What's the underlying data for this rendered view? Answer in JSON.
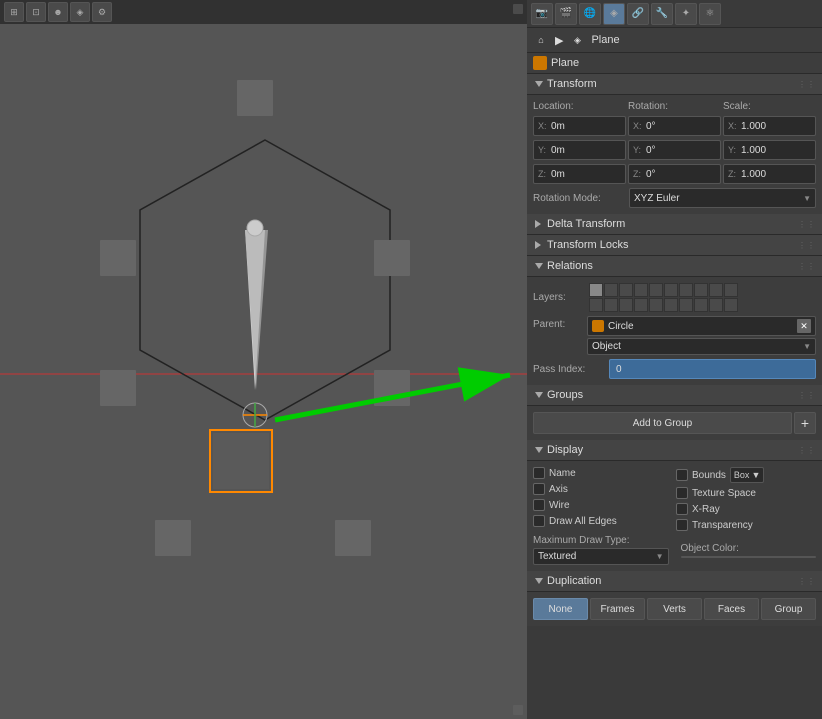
{
  "viewport": {
    "background_color": "#555555"
  },
  "toolbar": {
    "icons": [
      "⊞",
      "⊡",
      "○",
      "◉",
      "⚙",
      "↗",
      "⊿",
      "▦",
      "✦"
    ]
  },
  "header": {
    "object_type_icon": "✦",
    "object_name": "Plane",
    "breadcrumb_arrow": "▶",
    "plane_icon_label": "Plane"
  },
  "transform": {
    "section_label": "Transform",
    "location_label": "Location:",
    "rotation_label": "Rotation:",
    "scale_label": "Scale:",
    "x_label": "X:",
    "y_label": "Y:",
    "z_label": "Z:",
    "loc_x": "0m",
    "loc_y": "0m",
    "loc_z": "0m",
    "rot_x": "0°",
    "rot_y": "0°",
    "rot_z": "0°",
    "scale_x": "1.000",
    "scale_y": "1.000",
    "scale_z": "1.000",
    "rotation_mode_label": "Rotation Mode:",
    "rotation_mode_value": "XYZ Euler"
  },
  "delta_transform": {
    "section_label": "Delta Transform"
  },
  "transform_locks": {
    "section_label": "Transform Locks"
  },
  "relations": {
    "section_label": "Relations",
    "layers_label": "Layers:",
    "parent_label": "Parent:",
    "parent_value": "Circle",
    "parent_type_value": "Object",
    "pass_index_label": "Pass Index:",
    "pass_index_value": "0"
  },
  "groups": {
    "section_label": "Groups",
    "add_to_group_label": "Add to Group"
  },
  "display": {
    "section_label": "Display",
    "name_label": "Name",
    "axis_label": "Axis",
    "wire_label": "Wire",
    "draw_all_edges_label": "Draw All Edges",
    "bounds_label": "Bounds",
    "bounds_type": "Box",
    "texture_space_label": "Texture Space",
    "x_ray_label": "X-Ray",
    "transparency_label": "Transparency",
    "max_draw_type_label": "Maximum Draw Type:",
    "max_draw_type_value": "Textured",
    "object_color_label": "Object Color:"
  },
  "duplication": {
    "section_label": "Duplication",
    "none_label": "None",
    "frames_label": "Frames",
    "verts_label": "Verts",
    "faces_label": "Faces",
    "group_label": "Group"
  },
  "colors": {
    "section_header_bg": "#444444",
    "panel_bg": "#3a3a3a",
    "field_bg": "#2a2a2a",
    "active_blue": "#5a7a9a",
    "orange_icon": "#cc7700",
    "pass_index_bg": "#3d6b99"
  }
}
